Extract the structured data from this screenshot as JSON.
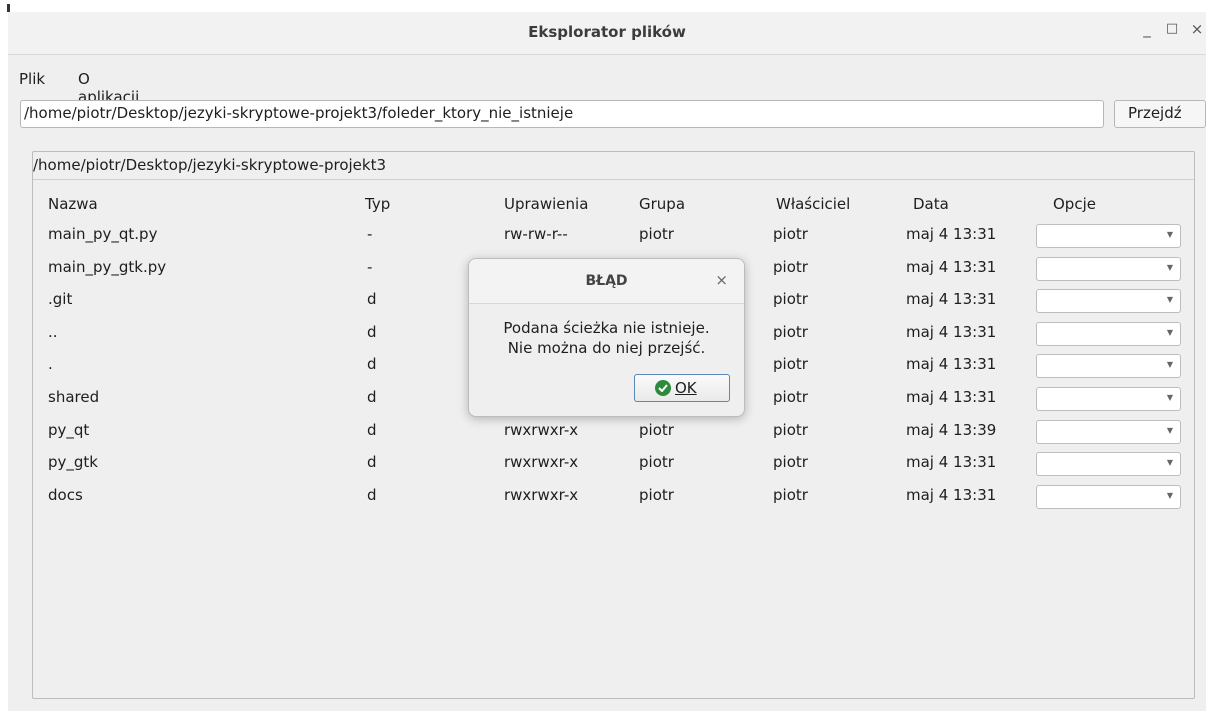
{
  "window": {
    "title": "Eksplorator plików",
    "minimize_icon": "_",
    "maximize_icon": "□",
    "close_icon": "×"
  },
  "menu": {
    "items": [
      "Plik",
      "O aplikacji"
    ]
  },
  "path_input": {
    "value": "/home/piotr/Desktop/jezyki-skryptowe-projekt3/foleder_ktory_nie_istnieje"
  },
  "go_button": {
    "label": "Przejdź"
  },
  "browser": {
    "current_path": "/home/piotr/Desktop/jezyki-skryptowe-projekt3",
    "columns": [
      "Nazwa",
      "Typ",
      "Uprawienia",
      "Grupa",
      "Właściciel",
      "Data",
      "Opcje"
    ],
    "rows": [
      {
        "name": "main_py_qt.py",
        "type": "-",
        "perm": "rw-rw-r--",
        "group": "piotr",
        "owner": "piotr",
        "date": "maj  4 13:31",
        "option": ""
      },
      {
        "name": "main_py_gtk.py",
        "type": "-",
        "perm": "",
        "group": "",
        "owner": "piotr",
        "date": "maj  4 13:31",
        "option": ""
      },
      {
        "name": ".git",
        "type": "d",
        "perm": "",
        "group": "",
        "owner": "piotr",
        "date": "maj  4 13:31",
        "option": ""
      },
      {
        "name": "..",
        "type": "d",
        "perm": "",
        "group": "",
        "owner": "piotr",
        "date": "maj  4 13:31",
        "option": ""
      },
      {
        "name": ".",
        "type": "d",
        "perm": "",
        "group": "",
        "owner": "piotr",
        "date": "maj  4 13:31",
        "option": ""
      },
      {
        "name": "shared",
        "type": "d",
        "perm": "",
        "group": "",
        "owner": "piotr",
        "date": "maj  4 13:31",
        "option": ""
      },
      {
        "name": "py_qt",
        "type": "d",
        "perm": "rwxrwxr-x",
        "group": "piotr",
        "owner": "piotr",
        "date": "maj  4 13:39",
        "option": ""
      },
      {
        "name": "py_gtk",
        "type": "d",
        "perm": "rwxrwxr-x",
        "group": "piotr",
        "owner": "piotr",
        "date": "maj  4 13:31",
        "option": ""
      },
      {
        "name": "docs",
        "type": "d",
        "perm": "rwxrwxr-x",
        "group": "piotr",
        "owner": "piotr",
        "date": "maj  4 13:31",
        "option": ""
      }
    ],
    "combo_arrow_icon": "▼"
  },
  "dialog": {
    "title": "BŁĄD",
    "close_icon": "×",
    "message_line1": "Podana ścieżka nie istnieje.",
    "message_line2": "Nie można do niej przejść.",
    "ok_label": "OK",
    "ok_icon": "check-circle-icon",
    "ok_icon_color": "#2e8b3e"
  }
}
